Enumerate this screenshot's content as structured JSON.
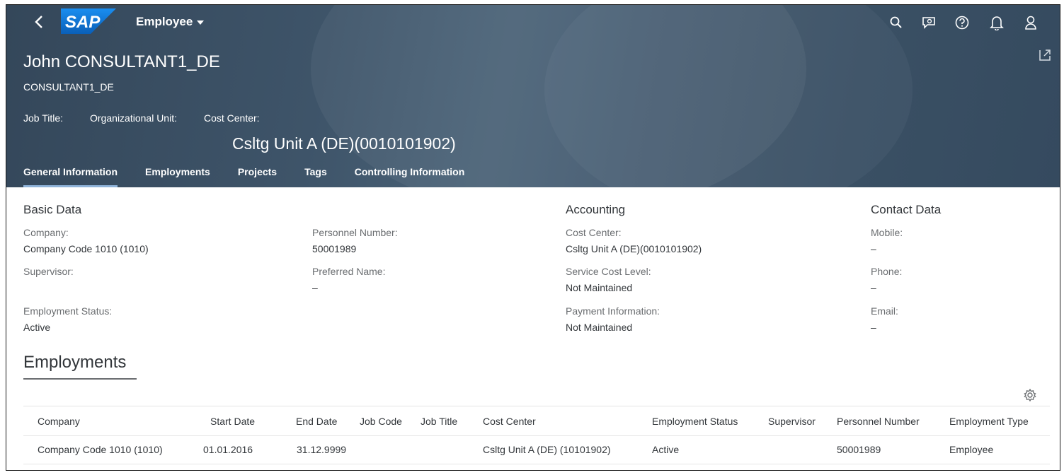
{
  "shell": {
    "logo_text": "SAP",
    "app_title": "Employee",
    "icons": [
      "search-icon",
      "feedback-icon",
      "help-icon",
      "notifications-icon",
      "user-icon"
    ]
  },
  "object": {
    "title": "John CONSULTANT1_DE",
    "subtitle": "CONSULTANT1_DE",
    "attributes": {
      "job_title_label": "Job Title:",
      "org_unit_label": "Organizational Unit:",
      "cost_center_label": "Cost Center:"
    },
    "cost_center_value": "Csltg Unit A (DE)(0010101902)"
  },
  "tabs": [
    {
      "label": "General Information",
      "active": true
    },
    {
      "label": "Employments"
    },
    {
      "label": "Projects"
    },
    {
      "label": "Tags"
    },
    {
      "label": "Controlling Information"
    }
  ],
  "basic_data": {
    "heading": "Basic Data",
    "company_label": "Company:",
    "company_value": "Company Code 1010 (1010)",
    "personnel_label": "Personnel Number:",
    "personnel_value": "50001989",
    "supervisor_label": "Supervisor:",
    "preferred_label": "Preferred Name:",
    "preferred_value": "–",
    "status_label": "Employment Status:",
    "status_value": "Active"
  },
  "accounting": {
    "heading": "Accounting",
    "cost_center_label": "Cost Center:",
    "cost_center_value": "Csltg Unit A (DE)(0010101902)",
    "service_label": "Service Cost Level:",
    "service_value": "Not Maintained",
    "payment_label": "Payment Information:",
    "payment_value": "Not Maintained"
  },
  "contact": {
    "heading": "Contact Data",
    "mobile_label": "Mobile:",
    "mobile_value": "–",
    "phone_label": "Phone:",
    "phone_value": "–",
    "email_label": "Email:",
    "email_value": "–"
  },
  "employments": {
    "title": "Employments",
    "columns": [
      "Company",
      "Start Date",
      "End Date",
      "Job Code",
      "Job Title",
      "Cost Center",
      "Employment Status",
      "Supervisor",
      "Personnel Number",
      "Employment Type"
    ],
    "rows": [
      [
        "Company Code 1010 (1010)",
        "01.01.2016",
        "31.12.9999",
        "",
        "",
        "Csltg Unit A (DE) (10101902)",
        "Active",
        "",
        "50001989",
        "Employee"
      ]
    ]
  },
  "colors": {
    "header_bg": "#354a5f",
    "sap_logo_blue": "#0a6ed1",
    "tab_indicator": "#8fb3d9"
  }
}
